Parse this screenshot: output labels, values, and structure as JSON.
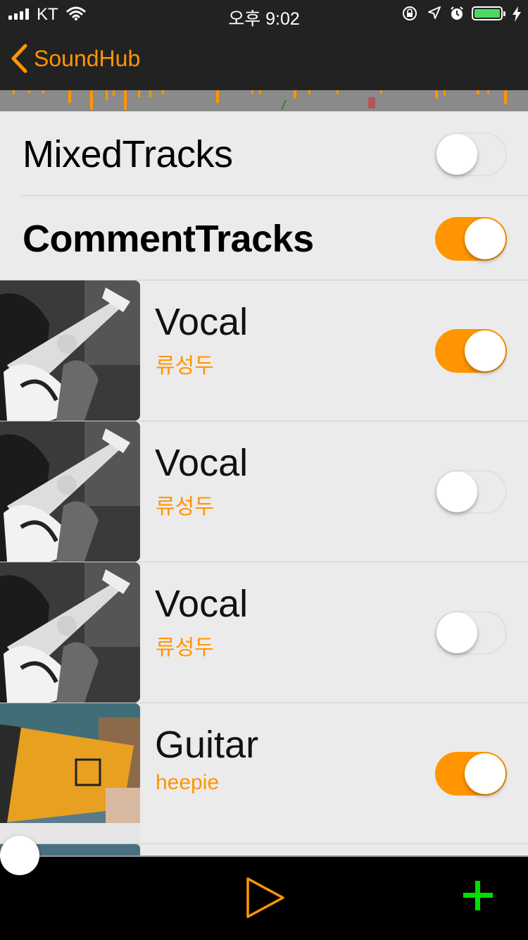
{
  "status_bar": {
    "carrier": "KT",
    "time": "오후 9:02"
  },
  "nav": {
    "back_label": "SoundHub"
  },
  "sections": [
    {
      "title": "MixedTracks",
      "enabled": false
    },
    {
      "title": "CommentTracks",
      "enabled": true
    }
  ],
  "tracks": [
    {
      "name": "Vocal",
      "artist": "류성두",
      "enabled": true,
      "thumbnail": "guitarist-photo"
    },
    {
      "name": "Vocal",
      "artist": "류성두",
      "enabled": false,
      "thumbnail": "guitarist-photo"
    },
    {
      "name": "Vocal",
      "artist": "류성두",
      "enabled": false,
      "thumbnail": "guitarist-photo"
    },
    {
      "name": "Guitar",
      "artist": "heepie",
      "enabled": true,
      "thumbnail": "cup-photo"
    }
  ],
  "colors": {
    "accent": "#ff9500",
    "bar": "#222222",
    "add": "#00e000",
    "background": "#ebebeb"
  },
  "toolbar": {
    "play_icon": "play-icon",
    "add_icon": "plus-icon"
  },
  "playback": {
    "position_fraction": 0.0
  }
}
